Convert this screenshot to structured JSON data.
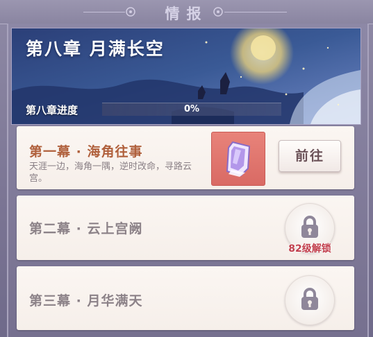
{
  "header": {
    "title": "情报"
  },
  "chapter": {
    "title": "第八章 月满长空",
    "progress_label": "第八章进度",
    "progress_text": "0%",
    "progress_fraction": 0
  },
  "acts": [
    {
      "title": "第一幕 · 海角往事",
      "description": "天涯一边，海角一隅，逆时改命，寻路云宫。",
      "button_label": "前往",
      "item_icon": "purple-crystal-item-icon"
    },
    {
      "title": "第二幕 · 云上宫阙",
      "unlock_requirement": "82级解锁",
      "icon": "lock-icon"
    },
    {
      "title": "第三幕 · 月华满天",
      "icon": "lock-icon"
    }
  ],
  "colors": {
    "active_title": "#b0603c",
    "locked_title": "#8c8288",
    "unlock_text": "#c2404e",
    "item_slot": "#e0756e"
  }
}
